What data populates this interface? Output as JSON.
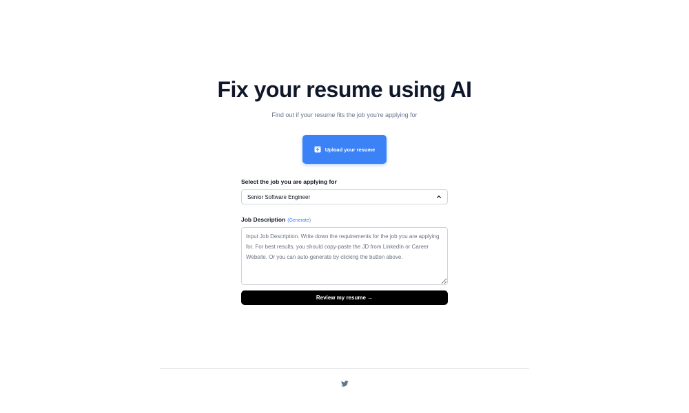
{
  "hero": {
    "title": "Fix your resume using AI",
    "subtitle": "Find out if your resume fits the job you're applying for"
  },
  "upload": {
    "label": "Upload your resume",
    "icon": "file-icon"
  },
  "job_select": {
    "label": "Select the job you are applying for",
    "selected": "Senior Software Engineer"
  },
  "job_description": {
    "label": "Job Description",
    "generate_label": "(Generate)",
    "placeholder": "Input Job Description. Write down the requirements for the job you are applying for. For best results, you should copy-paste the JD from LinkedIn or Career Website. Or you can auto-generate by clicking the button above."
  },
  "review_button": {
    "label": "Review my resume →"
  },
  "footer": {
    "icon": "twitter-icon"
  },
  "colors": {
    "accent": "#3b82f6",
    "title": "#0f172a",
    "muted": "#64748b",
    "button_dark": "#000000"
  }
}
